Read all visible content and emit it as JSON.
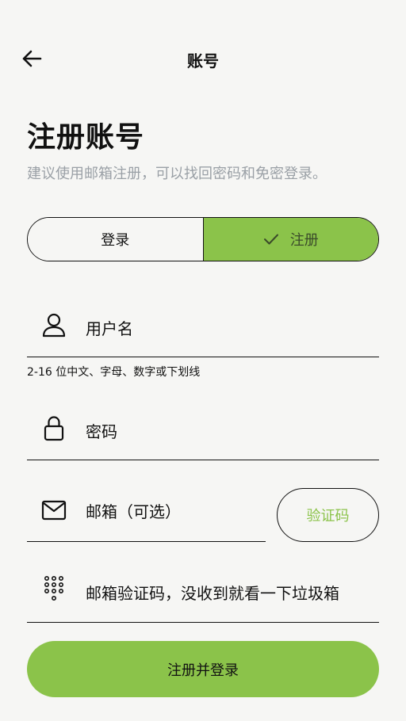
{
  "header": {
    "title": "账号",
    "back_icon": "arrow-left-icon"
  },
  "intro": {
    "title": "注册账号",
    "subtitle": "建议使用邮箱注册，可以找回密码和免密登录。"
  },
  "segment": {
    "login_label": "登录",
    "register_label": "注册",
    "selected": "register",
    "check_icon": "check-icon"
  },
  "form": {
    "username": {
      "placeholder": "用户名",
      "icon": "person-icon",
      "helper": "2-16 位中文、字母、数字或下划线"
    },
    "password": {
      "placeholder": "密码",
      "icon": "lock-icon"
    },
    "email": {
      "placeholder": "邮箱（可选）",
      "icon": "mail-icon"
    },
    "send_code_label": "验证码",
    "code": {
      "placeholder": "邮箱验证码，没收到就看一下垃圾箱",
      "icon": "dialpad-icon"
    }
  },
  "submit_label": "注册并登录",
  "colors": {
    "accent": "#8bc34a",
    "background": "#f6f6f4",
    "muted_text": "#9aa0a6"
  }
}
